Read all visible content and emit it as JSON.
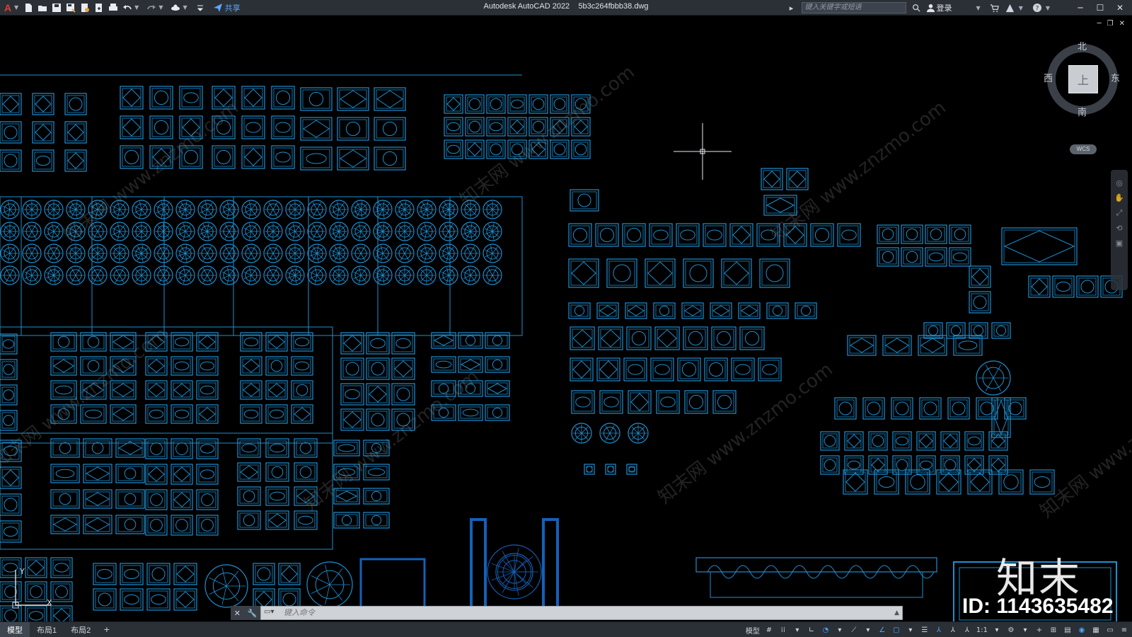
{
  "app": {
    "title": "Autodesk AutoCAD 2022",
    "filename": "5b3c264fbbb38.dwg",
    "logo": "A"
  },
  "quick_access": {
    "items": [
      "new-icon",
      "open-icon",
      "save-icon",
      "save-as-icon",
      "open-from-web-icon",
      "save-to-web-icon",
      "plot-icon",
      "undo-icon",
      "redo-icon",
      "workspace-icon"
    ],
    "share_label": "共享"
  },
  "titlebar_right": {
    "search_placeholder": "键入关键字或短语",
    "login_label": "登录"
  },
  "viewcube": {
    "north": "北",
    "south": "南",
    "east": "东",
    "west": "西",
    "face": "上",
    "wcs": "WCS"
  },
  "ucs": {
    "x_label": "X",
    "y_label": "Y"
  },
  "command_line": {
    "placeholder": "键入命令"
  },
  "layout_tabs": [
    {
      "label": "模型",
      "active": true
    },
    {
      "label": "布局1",
      "active": false
    },
    {
      "label": "布局2",
      "active": false
    }
  ],
  "add_tab": "+",
  "status_bar": {
    "model_label": "模型",
    "scale_label": "1:1"
  },
  "watermark": {
    "logo_text": "知末",
    "id_text": "ID: 1143635482",
    "tile_text": "知末网 www.znzmo.com"
  },
  "colors": {
    "canvas_bg": "#000000",
    "linework": "#1e8fd0",
    "linework_dark": "#1560b8",
    "ui_bar": "#2b2f36",
    "accent": "#4aa8ff"
  }
}
